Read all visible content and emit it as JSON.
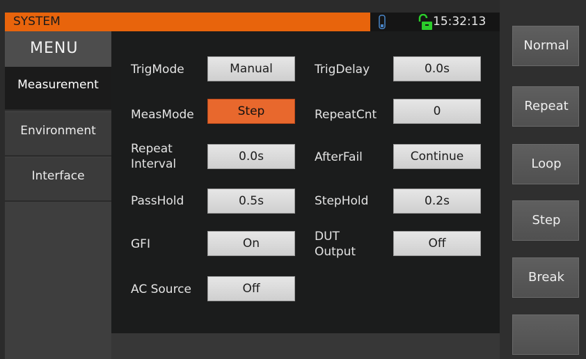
{
  "header": {
    "title": "SYSTEM",
    "time": "15:32:13",
    "icons": [
      "usb-icon",
      "unlock-icon"
    ],
    "accent_color": "#e8640c"
  },
  "menu": {
    "title": "MENU",
    "items": [
      {
        "label": "Measurement",
        "active": true
      },
      {
        "label": "Environment",
        "active": false
      },
      {
        "label": "Interface",
        "active": false
      }
    ]
  },
  "settings": {
    "trig_mode": {
      "label": "TrigMode",
      "value": "Manual"
    },
    "meas_mode": {
      "label": "MeasMode",
      "value": "Step"
    },
    "repeat_interval": {
      "label_line1": "Repeat",
      "label_line2": "Interval",
      "value": "0.0s"
    },
    "pass_hold": {
      "label": "PassHold",
      "value": "0.5s"
    },
    "gfi": {
      "label": "GFI",
      "value": "On"
    },
    "ac_source": {
      "label": "AC Source",
      "value": "Off"
    },
    "trig_delay": {
      "label": "TrigDelay",
      "value": "0.0s"
    },
    "repeat_cnt": {
      "label": "RepeatCnt",
      "value": "0"
    },
    "after_fail": {
      "label": "AfterFail",
      "value": "Continue"
    },
    "step_hold": {
      "label": "StepHold",
      "value": "0.2s"
    },
    "dut_output": {
      "label_line1": "DUT",
      "label_line2": "Output",
      "value": "Off"
    }
  },
  "softkeys": [
    "Normal",
    "Repeat",
    "Loop",
    "Step",
    "Break",
    ""
  ]
}
